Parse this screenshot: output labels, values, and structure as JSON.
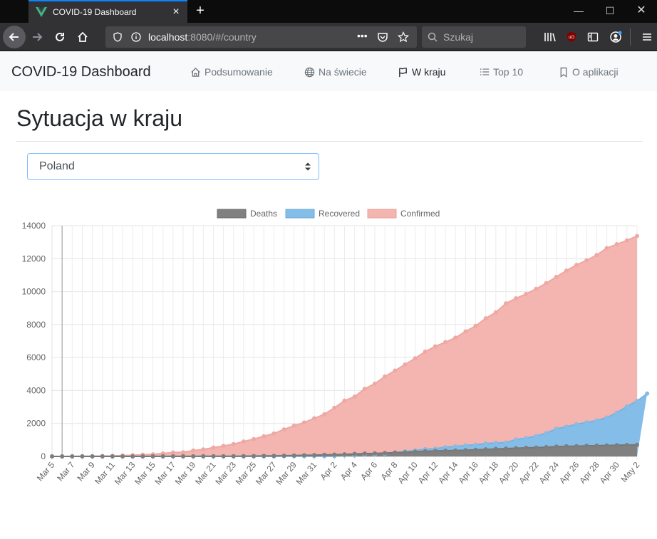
{
  "browser": {
    "tab_title": "COVID-19 Dashboard",
    "url_host": "localhost",
    "url_path": ":8080/#/country",
    "search_placeholder": "Szukaj",
    "page_actions": "•••"
  },
  "app": {
    "brand": "COVID-19 Dashboard",
    "nav": [
      {
        "label": "Podsumowanie",
        "icon": "home-icon"
      },
      {
        "label": "Na świecie",
        "icon": "globe-icon"
      },
      {
        "label": "W kraju",
        "icon": "flag-icon",
        "active": true
      },
      {
        "label": "Top 10",
        "icon": "list-icon"
      },
      {
        "label": "O aplikacji",
        "icon": "bookmark-icon"
      }
    ],
    "page_title": "Sytuacja w kraju",
    "country_select": "Poland"
  },
  "chart_data": {
    "type": "area",
    "legend": [
      "Deaths",
      "Recovered",
      "Confirmed"
    ],
    "legend_position": "top",
    "colors": {
      "Deaths": "#808080",
      "Recovered": "#84bde8",
      "Confirmed": "#f4b5b0"
    },
    "x_tick_labels": [
      "Mar 5",
      "Mar 7",
      "Mar 9",
      "Mar 11",
      "Mar 13",
      "Mar 15",
      "Mar 17",
      "Mar 19",
      "Mar 21",
      "Mar 23",
      "Mar 25",
      "Mar 27",
      "Mar 29",
      "Mar 31",
      "Apr 2",
      "Apr 4",
      "Apr 6",
      "Apr 8",
      "Apr 10",
      "Apr 12",
      "Apr 14",
      "Apr 16",
      "Apr 18",
      "Apr 20",
      "Apr 22",
      "Apr 24",
      "Apr 26",
      "Apr 28",
      "Apr 30",
      "May 2"
    ],
    "x_start": "Mar 5",
    "x_end": "May 2",
    "ylim": [
      0,
      14000
    ],
    "y_ticks": [
      0,
      2000,
      4000,
      6000,
      8000,
      10000,
      12000,
      14000
    ],
    "grid": true,
    "series": [
      {
        "name": "Confirmed",
        "values": [
          1,
          1,
          5,
          11,
          17,
          22,
          31,
          51,
          68,
          104,
          125,
          177,
          238,
          251,
          355,
          425,
          536,
          634,
          749,
          901,
          1051,
          1221,
          1389,
          1638,
          1862,
          2055,
          2311,
          2554,
          2946,
          3383,
          3627,
          4102,
          4413,
          4848,
          5205,
          5575,
          5955,
          6356,
          6674,
          6934,
          7202,
          7582,
          7918,
          8379,
          8742,
          9287,
          9593,
          9856,
          10169,
          10511,
          10892,
          11273,
          11617,
          11902,
          12218,
          12640,
          12877,
          13105,
          13375
        ]
      },
      {
        "name": "Recovered",
        "values": [
          0,
          0,
          0,
          0,
          0,
          0,
          0,
          0,
          0,
          0,
          0,
          0,
          0,
          1,
          1,
          1,
          1,
          1,
          1,
          1,
          1,
          1,
          1,
          7,
          7,
          7,
          13,
          13,
          13,
          56,
          56,
          116,
          116,
          162,
          233,
          302,
          357,
          441,
          464,
          558,
          610,
          665,
          710,
          783,
          817,
          839,
          1026,
          1108,
          1234,
          1418,
          1672,
          1796,
          1949,
          2058,
          2178,
          2355,
          2655,
          3030,
          3357,
          3811
        ]
      },
      {
        "name": "Deaths",
        "values": [
          0,
          0,
          0,
          0,
          0,
          0,
          0,
          0,
          0,
          1,
          3,
          3,
          4,
          5,
          5,
          7,
          8,
          10,
          14,
          16,
          22,
          29,
          33,
          43,
          57,
          71,
          79,
          94,
          107,
          124,
          152,
          174,
          181,
          208,
          232,
          251,
          286,
          314,
          332,
          347,
          360,
          380,
          401,
          426,
          454,
          476,
          499,
          524,
          535,
          562,
          596,
          614,
          624,
          644,
          651,
          664,
          678,
          690,
          698
        ]
      }
    ]
  }
}
